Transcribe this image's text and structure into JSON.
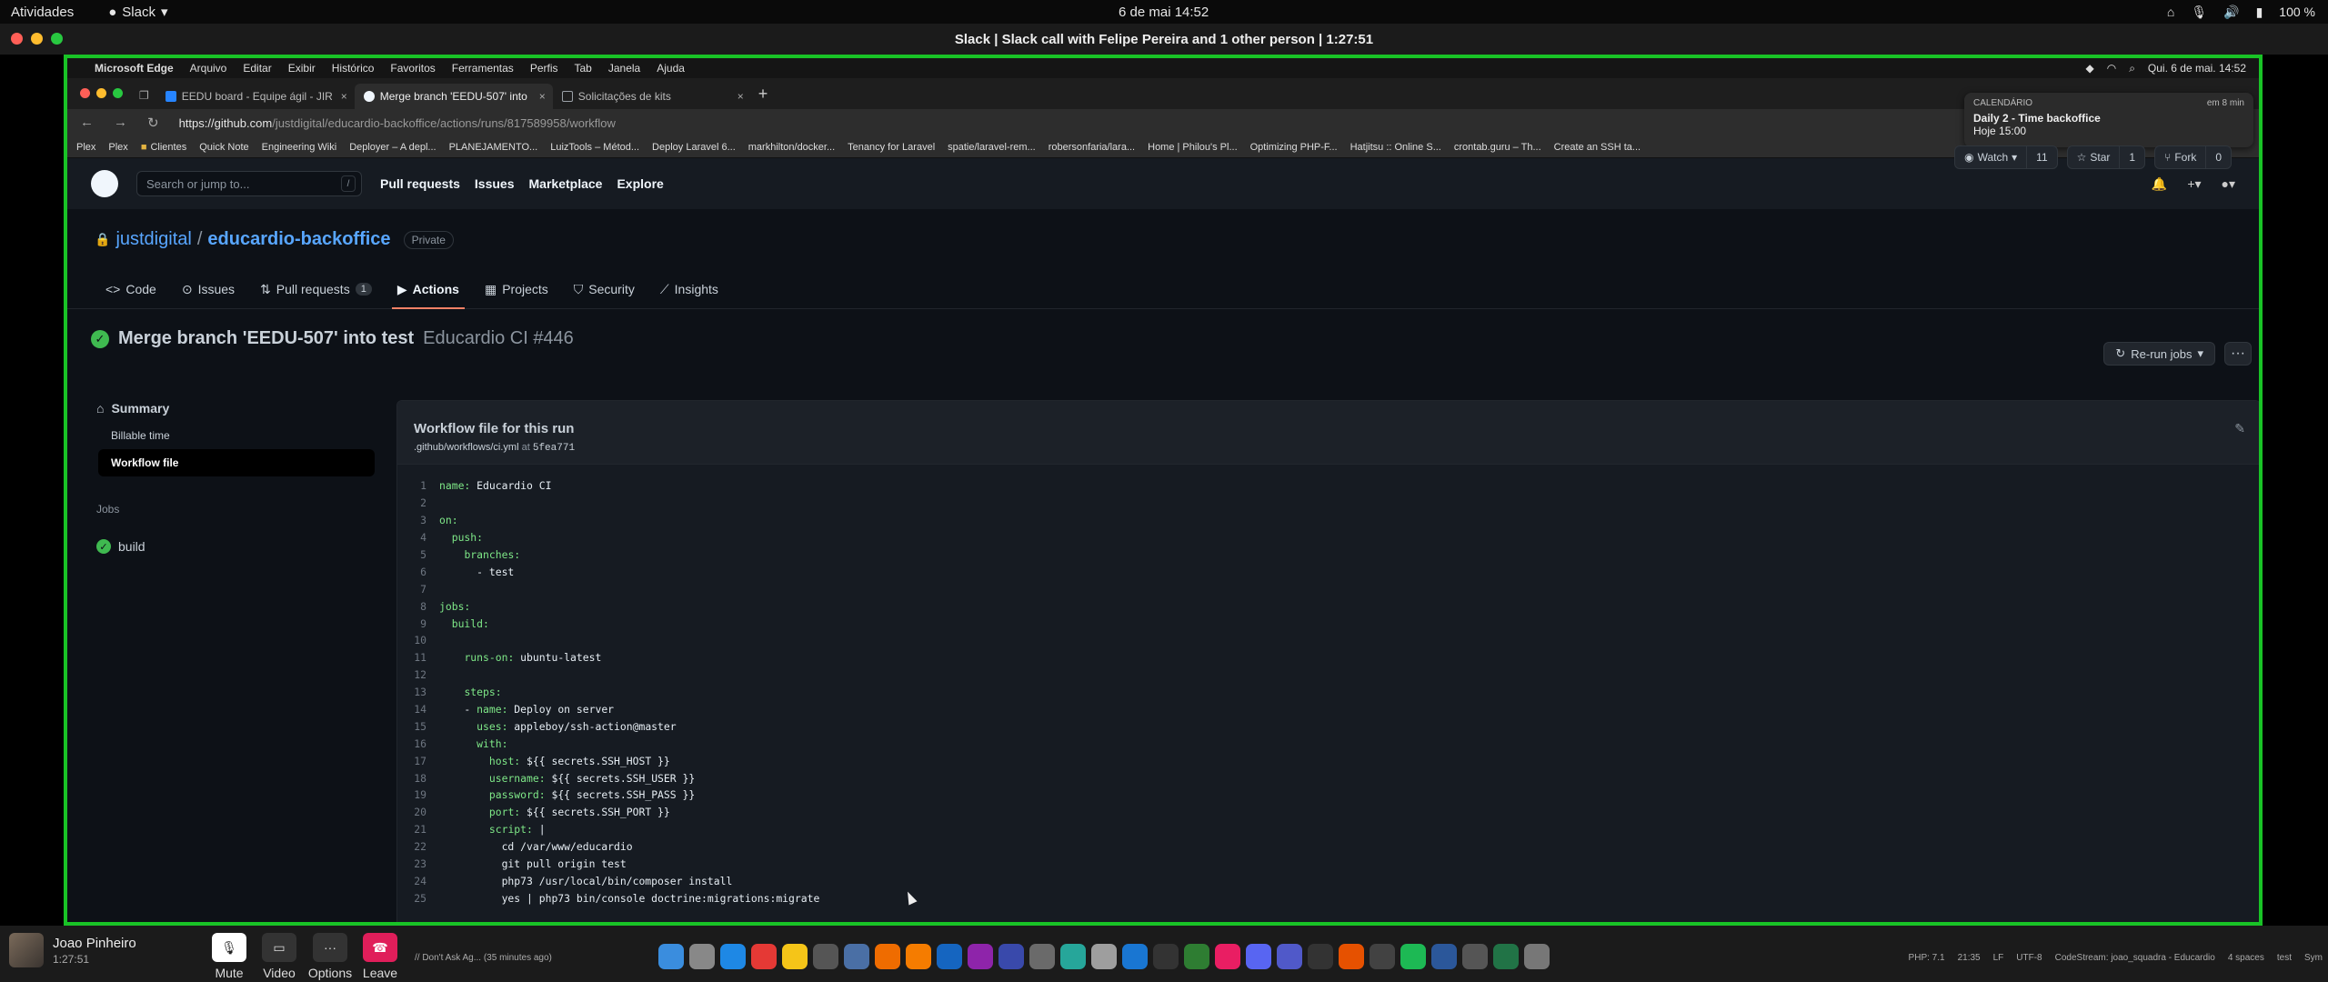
{
  "gnome": {
    "activities": "Atividades",
    "app": "Slack",
    "clock": "6 de mai  14:52",
    "battery": "100 %"
  },
  "slack_window": {
    "title": "Slack | Slack call with Felipe Pereira and 1 other person | 1:27:51"
  },
  "mac_menu": {
    "app": "Microsoft Edge",
    "items": [
      "Arquivo",
      "Editar",
      "Exibir",
      "Histórico",
      "Favoritos",
      "Ferramentas",
      "Perfis",
      "Tab",
      "Janela",
      "Ajuda"
    ],
    "datetime": "Qui. 6 de mai.  14:52"
  },
  "browser": {
    "tabs": [
      {
        "label": "EEDU board - Equipe ágil - JIR",
        "color": "#2684ff"
      },
      {
        "label": "Merge branch 'EEDU-507' into",
        "color": "#f0f6fc"
      },
      {
        "label": "Solicitações de kits",
        "color": "#9aa0a6"
      }
    ],
    "url_host": "https://github.com",
    "url_path": "/justdigital/educardio-backoffice/actions/runs/817589958/workflow",
    "bookmarks": [
      "Plex",
      "Plex",
      "Clientes",
      "Quick Note",
      "Engineering Wiki",
      "Deployer – A depl...",
      "PLANEJAMENTO...",
      "LuizTools – Métod...",
      "Deploy Laravel 6...",
      "markhilton/docker...",
      "Tenancy for Laravel",
      "spatie/laravel-rem...",
      "robersonfaria/lara...",
      "Home | Philou's Pl...",
      "Optimizing PHP-F...",
      "Hatjitsu :: Online S...",
      "crontab.guru – Th...",
      "Create an SSH ta..."
    ]
  },
  "notification": {
    "app": "CALENDÁRIO",
    "time": "em 8 min",
    "title": "Daily 2 - Time backoffice",
    "subtitle": "Hoje 15:00"
  },
  "github": {
    "search_placeholder": "Search or jump to...",
    "search_key": "/",
    "nav": [
      "Pull requests",
      "Issues",
      "Marketplace",
      "Explore"
    ],
    "owner": "justdigital",
    "repo": "educardio-backoffice",
    "visibility": "Private",
    "watch": {
      "label": "Watch",
      "count": "11"
    },
    "star": {
      "label": "Star",
      "count": "1"
    },
    "fork": {
      "label": "Fork",
      "count": "0"
    },
    "tabs": [
      {
        "label": "Code",
        "icon": "code-icon"
      },
      {
        "label": "Issues",
        "icon": "issue-icon"
      },
      {
        "label": "Pull requests",
        "icon": "pr-icon",
        "count": "1"
      },
      {
        "label": "Actions",
        "icon": "play-icon"
      },
      {
        "label": "Projects",
        "icon": "project-icon"
      },
      {
        "label": "Security",
        "icon": "shield-icon"
      },
      {
        "label": "Insights",
        "icon": "graph-icon"
      }
    ],
    "run_title": "Merge branch 'EEDU-507' into test",
    "run_workflow": "Educardio CI #446",
    "rerun": "Re-run jobs",
    "sidebar": {
      "summary": "Summary",
      "billable": "Billable time",
      "workflow_file": "Workflow file",
      "jobs_label": "Jobs",
      "job": "build"
    },
    "panel": {
      "title": "Workflow file for this run",
      "path": ".github/workflows/ci.yml",
      "at": "at",
      "sha": "5fea771"
    },
    "code": [
      "name: Educardio CI",
      "",
      "on:",
      "  push:",
      "    branches:",
      "      - test",
      "",
      "jobs:",
      "  build:",
      "",
      "    runs-on: ubuntu-latest",
      "",
      "    steps:",
      "    - name: Deploy on server",
      "      uses: appleboy/ssh-action@master",
      "      with:",
      "        host: ${{ secrets.SSH_HOST }}",
      "        username: ${{ secrets.SSH_USER }}",
      "        password: ${{ secrets.SSH_PASS }}",
      "        port: ${{ secrets.SSH_PORT }}",
      "        script: |",
      "          cd /var/www/educardio",
      "          git pull origin test",
      "          php73 /usr/local/bin/composer install",
      "          yes | php73 bin/console doctrine:migrations:migrate"
    ]
  },
  "call": {
    "caller": "Joao Pinheiro",
    "duration": "1:27:51",
    "buttons": [
      "Mute",
      "Video",
      "Options",
      "Leave"
    ]
  },
  "statusbar": {
    "left": "// Don't Ask Ag... (35 minutes ago)",
    "right": [
      "PHP: 7.1",
      "21:35",
      "LF",
      "UTF-8",
      "CodeStream: joao_squadra - Educardio",
      "4 spaces",
      "test",
      "Sym"
    ]
  },
  "colors": {
    "share_border": "#19c326",
    "accent_tab": "#f78166",
    "success": "#3fb950"
  }
}
